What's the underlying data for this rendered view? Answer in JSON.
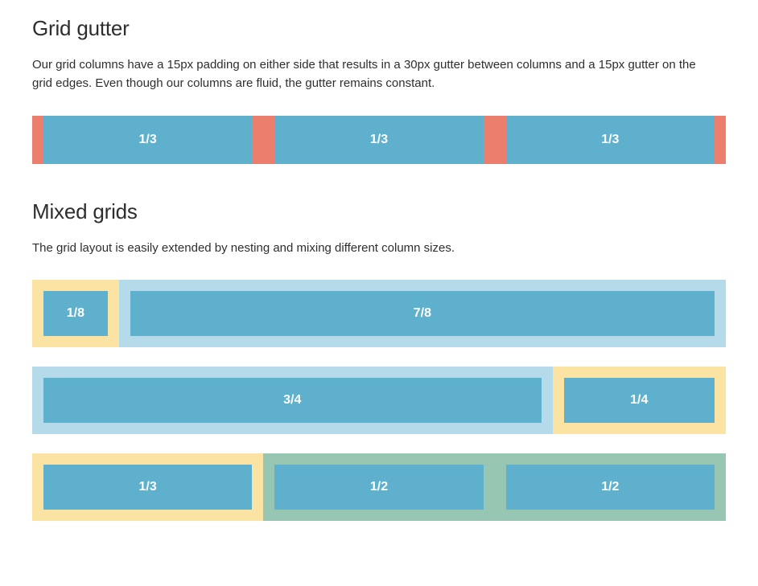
{
  "sections": {
    "gutter": {
      "heading": "Grid gutter",
      "description": "Our grid columns have a 15px padding on either side that results in a 30px gutter between columns and a 15px gutter on the grid edges. Even though our columns are fluid, the gutter remains constant.",
      "cols": [
        "1/3",
        "1/3",
        "1/3"
      ]
    },
    "mixed": {
      "heading": "Mixed grids",
      "description": "The grid layout is easily extended by nesting and mixing different column sizes.",
      "row1": {
        "a": "1/8",
        "b": "7/8"
      },
      "row2": {
        "a": "3/4",
        "b": "1/4"
      },
      "row3": {
        "a": "1/3",
        "b": "1/2",
        "c": "1/2"
      }
    }
  }
}
